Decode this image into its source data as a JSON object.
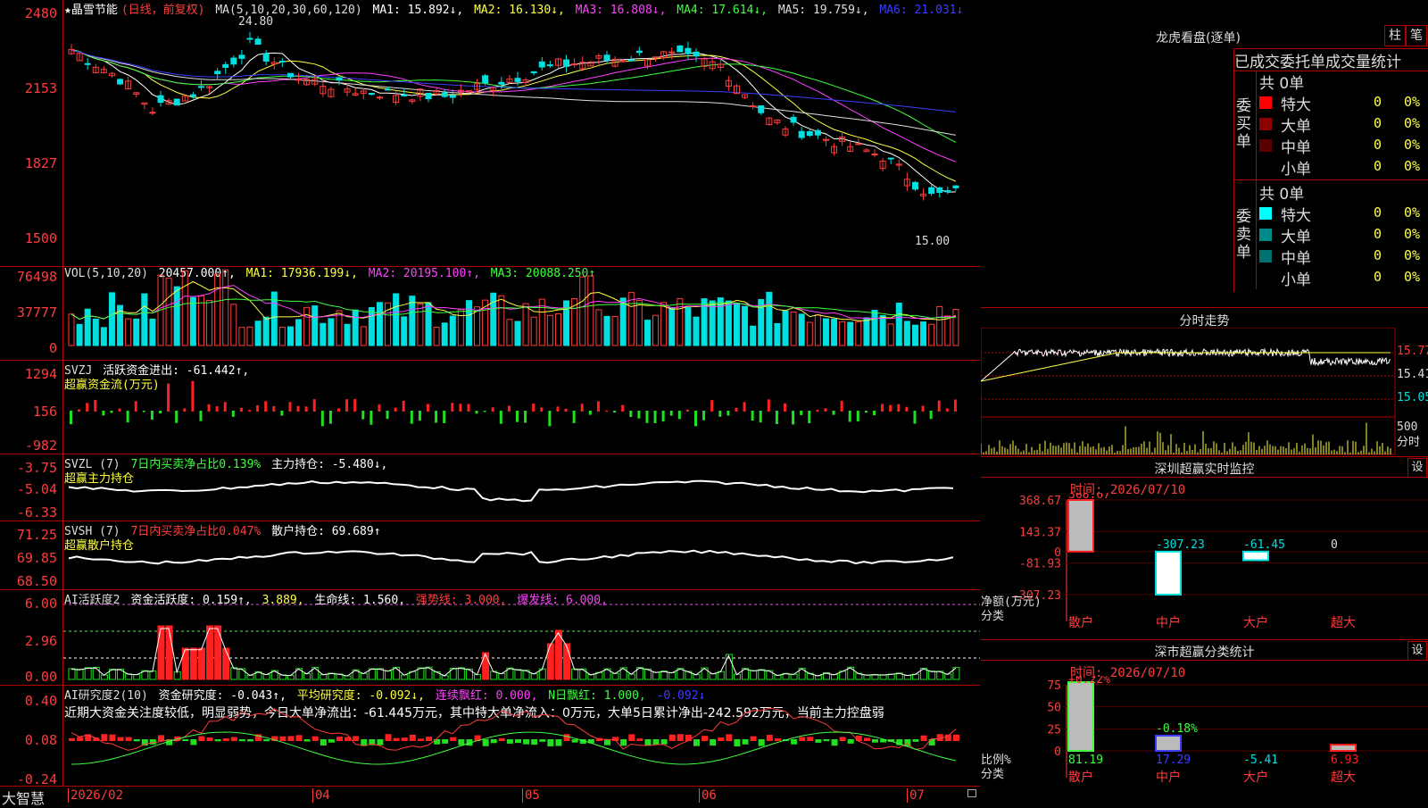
{
  "colors": {
    "up": "#ff3c3c",
    "down": "#00e0e0",
    "frame": "#b00000",
    "yellow": "#ffff40",
    "magenta": "#ff40ff",
    "green": "#40ff40",
    "white": "#ffffff",
    "blue": "#3c3cff"
  },
  "main": {
    "stock_name": "★晶雪节能",
    "period": "(日线，前复权)",
    "ma_label": "MA(5,10,20,30,60,120)",
    "ma1": "MA1: 15.892↓,",
    "ma2": "MA2: 16.130↓,",
    "ma3": "MA3: 16.808↓,",
    "ma4": "MA4: 17.614↓,",
    "ma5": "MA5: 19.759↓,",
    "ma6": "MA6: 21.031↓",
    "y_labels": [
      "2480",
      "2153",
      "1827",
      "1500"
    ],
    "high_marker": "24.80",
    "low_marker": "15.00"
  },
  "vol": {
    "label": "VOL(5,10,20)",
    "value": "20457.000↑,",
    "ma1": "MA1: 17936.199↓,",
    "ma2": "MA2: 20195.100↑,",
    "ma3": "MA3: 20088.250↑",
    "y_labels": [
      "76498",
      "37777",
      "0"
    ]
  },
  "svzj": {
    "label": "SVZJ",
    "desc": "活跃资金进出: -61.442↑,",
    "sub": "超赢资金流(万元)",
    "y_labels": [
      "1294",
      "156",
      "-982"
    ]
  },
  "svzl": {
    "label": "SVZL (7)",
    "desc1": "7日内买卖净占比0.139%",
    "desc2": "主力持仓: -5.480↓,",
    "sub": "超赢主力持仓",
    "y_labels": [
      "-3.75",
      "-5.04",
      "-6.33"
    ]
  },
  "svsh": {
    "label": "SVSH (7)",
    "desc1": "7日内买卖净占比0.047%",
    "desc2": "散户持仓: 69.689↑",
    "sub": "超赢散户持仓",
    "y_labels": [
      "71.25",
      "69.85",
      "68.50"
    ]
  },
  "ai_active": {
    "label": "AI活跃度2",
    "v1": "资金活跃度: 0.159↑,",
    "v2": "3.889,",
    "v3": "生命线: 1.560,",
    "v4": "强势线: 3.000,",
    "v5": "爆发线: 6.000,",
    "y_labels": [
      "6.00",
      "2.96",
      "0.00"
    ]
  },
  "ai_research": {
    "label": "AI研究度2(10)",
    "v1": "资金研究度: -0.043↑,",
    "v2": "平均研究度: -0.092↓,",
    "v3": "连续飘红: 0.000,",
    "v4": "N日飘红: 1.000,",
    "v5": "-0.092↓",
    "comment": "近期大资金关注度较低，明显弱势，今日大单净流出：-61.445万元，其中特大单净流入：0万元，大单5日累计净出-242.592万元，当前主力控盘弱",
    "y_labels": [
      "0.40",
      "0.08",
      "-0.24"
    ]
  },
  "bottom": {
    "brand": "大智慧",
    "dates": [
      "2026/02",
      "04",
      "05",
      "06",
      "07"
    ]
  },
  "lhb": {
    "title": "龙虎看盘(逐单)",
    "btn1": "柱",
    "btn2": "笔",
    "tabs": "已成交委托单成交量统计",
    "buy_side": "委买单",
    "sell_side": "委卖单",
    "buy_total": "共 0单",
    "sell_total": "共 0单",
    "buy_rows": [
      {
        "name": "特大",
        "count": "0",
        "pct": "0%"
      },
      {
        "name": "大单",
        "count": "0",
        "pct": "0%"
      },
      {
        "name": "中单",
        "count": "0",
        "pct": "0%"
      },
      {
        "name": "小单",
        "count": "0",
        "pct": "0%"
      }
    ],
    "sell_rows": [
      {
        "name": "特大",
        "count": "0",
        "pct": "0%"
      },
      {
        "name": "大单",
        "count": "0",
        "pct": "0%"
      },
      {
        "name": "中单",
        "count": "0",
        "pct": "0%"
      },
      {
        "name": "小单",
        "count": "0",
        "pct": "0%"
      }
    ]
  },
  "intraday": {
    "title": "分时走势",
    "prices": [
      "15.77",
      "15.41",
      "15.05"
    ],
    "vol_label": "500",
    "vol_unit": "分时"
  },
  "sz_monitor": {
    "title": "深圳超赢实时监控",
    "set_btn": "设",
    "time": "时间: 2026/07/10",
    "y_labels": [
      "368.67",
      "143.37",
      "0",
      "-81.93",
      "-307.23"
    ],
    "axis_title": "净额(万元)",
    "axis_sub": "分类",
    "categories": [
      "散户",
      "中户",
      "大户",
      "超大"
    ],
    "values": [
      "368.67",
      "-307.23",
      "-61.45",
      "0"
    ]
  },
  "sz_stats": {
    "title": "深市超赢分类统计",
    "set_btn": "设",
    "time": "时间: 2026/07/10",
    "y_labels": [
      "75",
      "50",
      "25",
      "0"
    ],
    "axis_title": "比例%",
    "axis_sub": "分类",
    "top_labels": [
      "+0.22%",
      "-0.18%"
    ],
    "categories": [
      "散户",
      "中户",
      "大户",
      "超大"
    ],
    "values": [
      "81.19",
      "17.29",
      "-5.41",
      "6.93"
    ]
  },
  "chart_data": [
    {
      "type": "bar",
      "categories": [
        "散户",
        "中户",
        "大户",
        "超大"
      ],
      "values": [
        368.67,
        -307.23,
        -61.45,
        0
      ],
      "title": "深圳超赢实时监控",
      "ylabel": "净额(万元)",
      "xlabel": "分类",
      "ylim": [
        -307.23,
        368.67
      ]
    },
    {
      "type": "bar",
      "categories": [
        "散户",
        "中户",
        "大户",
        "超大"
      ],
      "values": [
        81.19,
        17.29,
        -5.41,
        6.93
      ],
      "title": "深市超赢分类统计",
      "ylabel": "比例%",
      "xlabel": "分类",
      "ylim": [
        0,
        75
      ]
    }
  ]
}
